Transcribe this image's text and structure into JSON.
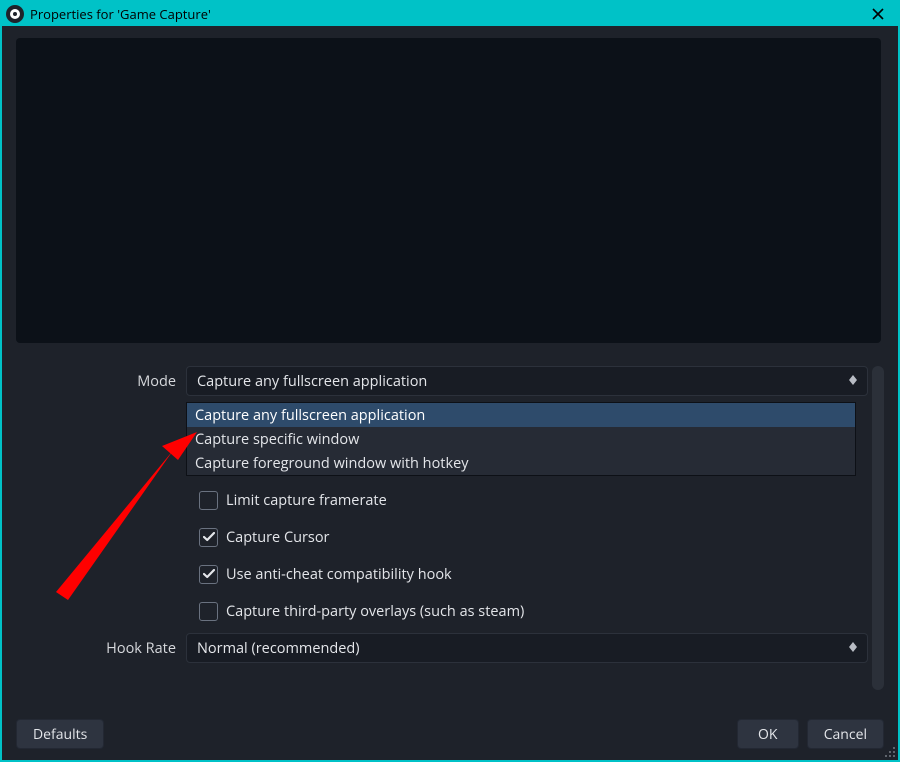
{
  "window": {
    "title": "Properties for 'Game Capture'"
  },
  "form": {
    "mode_label": "Mode",
    "mode_value": "Capture any fullscreen application",
    "mode_options": [
      "Capture any fullscreen application",
      "Capture specific window",
      "Capture foreground window with hotkey"
    ],
    "checkboxes": {
      "limit_framerate": {
        "label": "Limit capture framerate",
        "checked": false
      },
      "capture_cursor": {
        "label": "Capture Cursor",
        "checked": true
      },
      "anti_cheat": {
        "label": "Use anti-cheat compatibility hook",
        "checked": true
      },
      "third_party_overlays": {
        "label": "Capture third-party overlays (such as steam)",
        "checked": false
      }
    },
    "hook_rate_label": "Hook Rate",
    "hook_rate_value": "Normal (recommended)"
  },
  "buttons": {
    "defaults": "Defaults",
    "ok": "OK",
    "cancel": "Cancel"
  }
}
